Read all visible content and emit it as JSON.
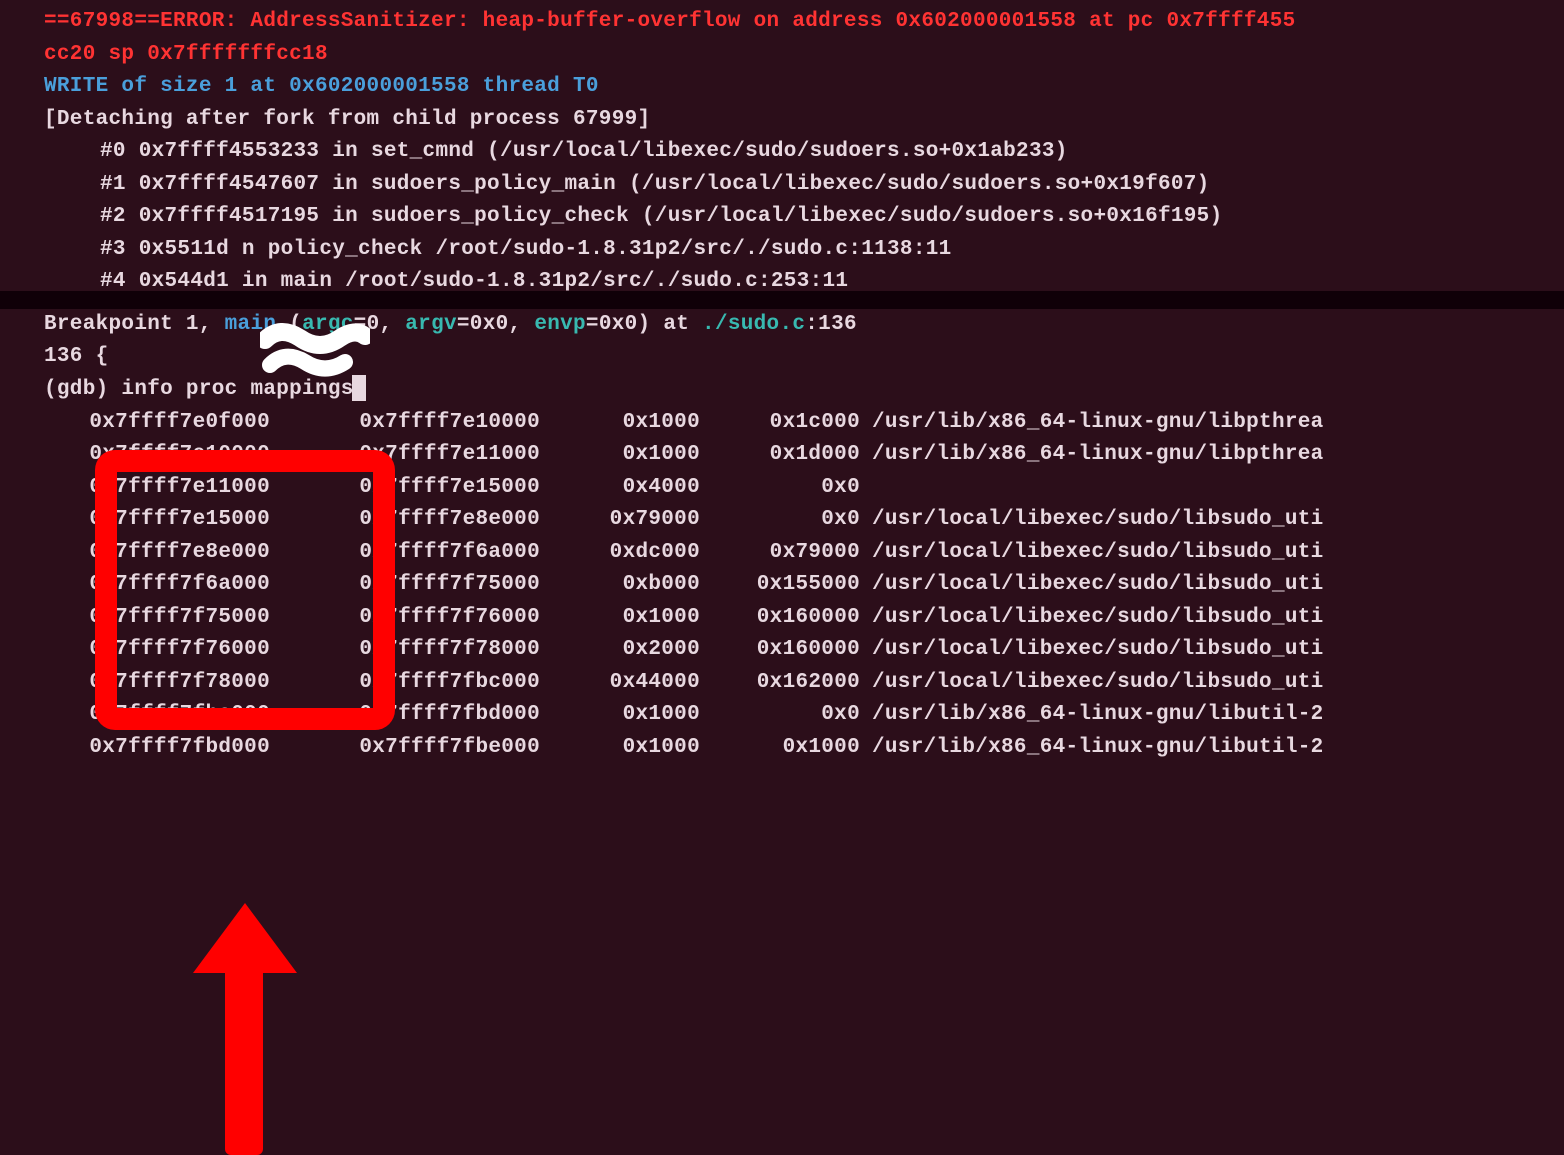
{
  "asan": {
    "line1": "==67998==ERROR: AddressSanitizer: heap-buffer-overflow on address 0x602000001558 at pc 0x7ffff455",
    "line2": "cc20 sp 0x7fffffffcc18",
    "write_line": "WRITE of size 1 at 0x602000001558 thread T0",
    "detaching": "[Detaching after fork from child process 67999]",
    "trace": [
      "#0 0x7ffff4553233 in set_cmnd (/usr/local/libexec/sudo/sudoers.so+0x1ab233)",
      "#1 0x7ffff4547607 in sudoers_policy_main (/usr/local/libexec/sudo/sudoers.so+0x19f607)",
      "#2 0x7ffff4517195 in sudoers_policy_check (/usr/local/libexec/sudo/sudoers.so+0x16f195)",
      "#3 0x5511d    n policy_check /root/sudo-1.8.31p2/src/./sudo.c:1138:11",
      "#4 0x544d1   in main /root/sudo-1.8.31p2/src/./sudo.c:253:11"
    ]
  },
  "gdb": {
    "bp_prefix": "Breakpoint 1, ",
    "bp_main": "main",
    "bp_args_open": " (",
    "bp_argc": "argc",
    "bp_eq0a": "=0, ",
    "bp_argv": "argv",
    "bp_eq0b": "=0x0, ",
    "bp_envp": "envp",
    "bp_eq0c": "=0x0) at ",
    "bp_file": "./sudo.c",
    "bp_line": ":136",
    "linecode": "136 {",
    "prompt": "(gdb) ",
    "cmd": "info proc mappings"
  },
  "mappings": [
    {
      "start": "0x7ffff7e0f000",
      "end": "0x7ffff7e10000",
      "size": "0x1000",
      "off": "0x1c000",
      "path": "/usr/lib/x86_64-linux-gnu/libpthrea"
    },
    {
      "start": "0x7ffff7e10000",
      "end": "0x7ffff7e11000",
      "size": "0x1000",
      "off": "0x1d000",
      "path": "/usr/lib/x86_64-linux-gnu/libpthrea"
    },
    {
      "start": "0x7ffff7e11000",
      "end": "0x7ffff7e15000",
      "size": "0x4000",
      "off": "0x0",
      "path": ""
    },
    {
      "start": "0x7ffff7e15000",
      "end": "0x7ffff7e8e000",
      "size": "0x79000",
      "off": "0x0",
      "path": "/usr/local/libexec/sudo/libsudo_uti"
    },
    {
      "start": "0x7ffff7e8e000",
      "end": "0x7ffff7f6a000",
      "size": "0xdc000",
      "off": "0x79000",
      "path": "/usr/local/libexec/sudo/libsudo_uti"
    },
    {
      "start": "0x7ffff7f6a000",
      "end": "0x7ffff7f75000",
      "size": "0xb000",
      "off": "0x155000",
      "path": "/usr/local/libexec/sudo/libsudo_uti"
    },
    {
      "start": "0x7ffff7f75000",
      "end": "0x7ffff7f76000",
      "size": "0x1000",
      "off": "0x160000",
      "path": "/usr/local/libexec/sudo/libsudo_uti"
    },
    {
      "start": "0x7ffff7f76000",
      "end": "0x7ffff7f78000",
      "size": "0x2000",
      "off": "0x160000",
      "path": "/usr/local/libexec/sudo/libsudo_uti"
    },
    {
      "start": "0x7ffff7f78000",
      "end": "0x7ffff7fbc000",
      "size": "0x44000",
      "off": "0x162000",
      "path": "/usr/local/libexec/sudo/libsudo_uti"
    },
    {
      "start": "0x7ffff7fbc000",
      "end": "0x7ffff7fbd000",
      "size": "0x1000",
      "off": "0x0",
      "path": "/usr/lib/x86_64-linux-gnu/libutil-2"
    },
    {
      "start": "0x7ffff7fbd000",
      "end": "0x7ffff7fbe000",
      "size": "0x1000",
      "off": "0x1000",
      "path": "/usr/lib/x86_64-linux-gnu/libutil-2"
    }
  ]
}
